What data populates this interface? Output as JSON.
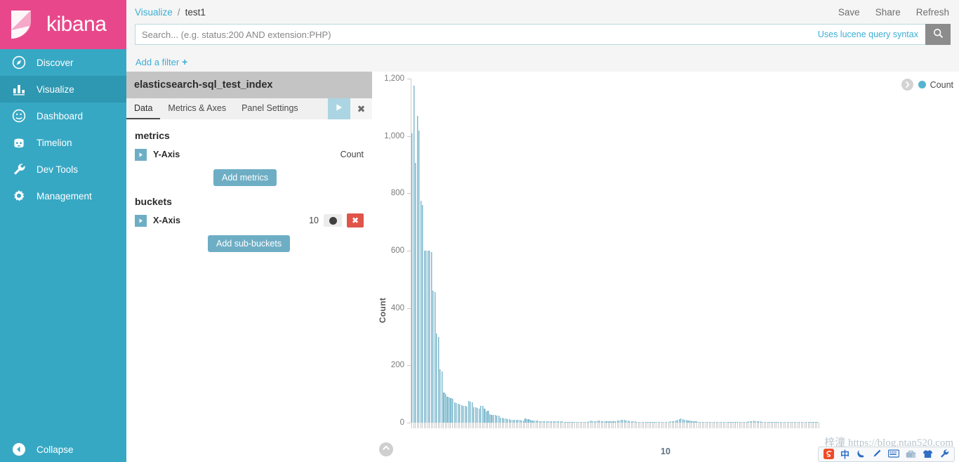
{
  "brand": {
    "name": "kibana",
    "logo_icon": "kibana-logo"
  },
  "sidebar": {
    "items": [
      {
        "label": "Discover",
        "icon": "compass-icon",
        "active": false
      },
      {
        "label": "Visualize",
        "icon": "bar-chart-icon",
        "active": true
      },
      {
        "label": "Dashboard",
        "icon": "dashboard-icon",
        "active": false
      },
      {
        "label": "Timelion",
        "icon": "timelion-icon",
        "active": false
      },
      {
        "label": "Dev Tools",
        "icon": "wrench-icon",
        "active": false
      },
      {
        "label": "Management",
        "icon": "gear-icon",
        "active": false
      }
    ],
    "collapse": {
      "label": "Collapse",
      "icon": "chevron-left-circle-icon"
    }
  },
  "breadcrumb": {
    "root": "Visualize",
    "separator": "/",
    "current": "test1"
  },
  "top_actions": [
    {
      "label": "Save"
    },
    {
      "label": "Share"
    },
    {
      "label": "Refresh"
    }
  ],
  "search": {
    "value": "",
    "placeholder": "Search... (e.g. status:200 AND extension:PHP)",
    "hint": "Uses lucene query syntax",
    "button_icon": "search-icon"
  },
  "filter": {
    "label": "Add a filter",
    "plus": "+"
  },
  "editor": {
    "index_title": "elasticsearch-sql_test_index",
    "tabs": [
      {
        "label": "Data",
        "active": true
      },
      {
        "label": "Metrics & Axes",
        "active": false
      },
      {
        "label": "Panel Settings",
        "active": false
      }
    ],
    "apply_icon": "play-icon",
    "discard_icon": "close-icon",
    "metrics_label": "metrics",
    "buckets_label": "buckets",
    "metric_rows": [
      {
        "name": "Y-Axis",
        "value": "Count",
        "expand_icon": "caret-right-icon"
      }
    ],
    "bucket_rows": [
      {
        "name": "X-Axis",
        "value": "10",
        "expand_icon": "caret-right-icon",
        "toggle_icon": "toggle-switch-icon",
        "remove_icon": "close-icon"
      }
    ],
    "add_metrics_label": "Add metrics",
    "add_subbuckets_label": "Add sub-buckets",
    "collapse_icon": "chevron-left-circle-icon"
  },
  "chart_panel": {
    "legend_toggle_icon": "chevron-right-circle-icon",
    "legend_label": "Count",
    "legend_color": "#54b4d1",
    "bottom_toggle_icon": "chevron-up-circle-icon"
  },
  "watermark": {
    "text": "梓潼 https://blog.ntan520.com"
  },
  "ime": {
    "icons": [
      "sogou-logo-icon",
      "chinese-mode-icon",
      "moon-icon",
      "pen-icon",
      "keyboard-icon",
      "toolbox-icon",
      "skin-icon",
      "wrench-icon"
    ]
  },
  "chart_data": {
    "type": "bar",
    "title": "",
    "xlabel": "10",
    "ylabel": "Count",
    "ylim": [
      0,
      1200
    ],
    "yticks": [
      0,
      200,
      400,
      600,
      800,
      1000,
      1200
    ],
    "ytick_labels": [
      "0",
      "200",
      "400",
      "600",
      "800",
      "1,000",
      "1,200"
    ],
    "grid": false,
    "legend": {
      "position": "top-right",
      "entries": [
        "Count"
      ]
    },
    "series": [
      {
        "name": "Count",
        "color": "#7cb8cd",
        "values": [
          1010,
          1175,
          905,
          1070,
          1020,
          775,
          760,
          600,
          600,
          600,
          600,
          595,
          460,
          455,
          310,
          300,
          185,
          180,
          105,
          100,
          90,
          88,
          86,
          84,
          70,
          68,
          66,
          64,
          62,
          60,
          58,
          56,
          75,
          74,
          72,
          55,
          54,
          52,
          50,
          60,
          58,
          48,
          40,
          42,
          30,
          28,
          27,
          26,
          25,
          24,
          18,
          16,
          15,
          14,
          13,
          12,
          11,
          11,
          10,
          10,
          9,
          9,
          8,
          8,
          14,
          13,
          12,
          9,
          8,
          8,
          7,
          7,
          6,
          6,
          6,
          5,
          5,
          5,
          5,
          5,
          4,
          4,
          4,
          4,
          4,
          4,
          3,
          3,
          3,
          3,
          3,
          3,
          3,
          3,
          3,
          3,
          3,
          3,
          3,
          3,
          6,
          7,
          6,
          5,
          5,
          8,
          7,
          6,
          5,
          5,
          4,
          4,
          4,
          4,
          5,
          6,
          7,
          8,
          9,
          10,
          9,
          8,
          7,
          6,
          5,
          4,
          4,
          3,
          3,
          3,
          3,
          3,
          3,
          3,
          3,
          3,
          3,
          3,
          3,
          3,
          3,
          3,
          3,
          3,
          3,
          3,
          4,
          5,
          6,
          8,
          10,
          12,
          14,
          12,
          10,
          9,
          8,
          7,
          6,
          5,
          4,
          4,
          3,
          3,
          3,
          3,
          3,
          3,
          3,
          3,
          3,
          3,
          3,
          3,
          3,
          3,
          3,
          3,
          3,
          3,
          3,
          3,
          3,
          3,
          3,
          3,
          3,
          3,
          3,
          3,
          4,
          5,
          6,
          7,
          6,
          5,
          4,
          4,
          3,
          3,
          3,
          3,
          3,
          3,
          3,
          3,
          3,
          3,
          3,
          3,
          3,
          3,
          3,
          3,
          3,
          3,
          3,
          3,
          3,
          3,
          3,
          3,
          3,
          3,
          3,
          3,
          3,
          3,
          3,
          3
        ]
      }
    ]
  }
}
